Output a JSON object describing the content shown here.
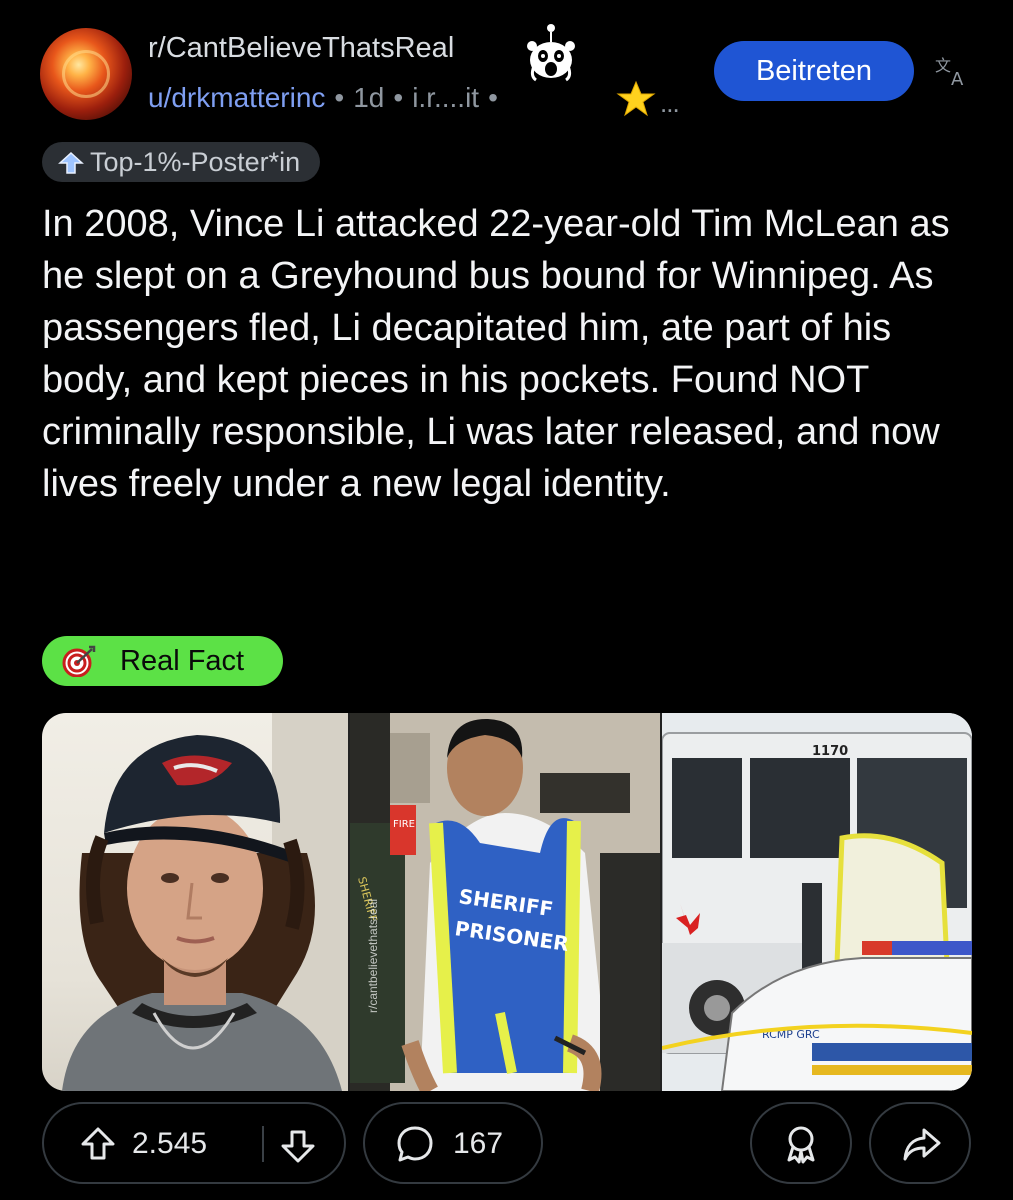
{
  "header": {
    "subreddit": "r/CantBelieveThatsReal",
    "user": "u/drkmatterinc",
    "age": "1d",
    "domain": "i.r....it",
    "more": "...",
    "separator": "•",
    "join_label": "Beitreten",
    "icons": [
      "subreddit-snoo-icon",
      "star-icon",
      "translate-icon"
    ]
  },
  "user_flair": {
    "label": "Top-1%-Poster*in",
    "icon": "top-poster-icon"
  },
  "post": {
    "title": "In 2008, Vince Li attacked 22-year-old Tim McLean as he slept on a Greyhound bus bound for Winnipeg. As passengers fled, Li decapitated him, ate part of his body, and kept pieces in his pockets. Found NOT criminally responsible, Li was later released, and now lives freely under a new legal identity.",
    "flair": {
      "label": "Real Fact",
      "icon": "target-icon",
      "color": "#5ce146"
    }
  },
  "gallery": {
    "watermark": "r/cantbelievethatsreal",
    "panels": [
      {
        "name": "portrait-young-man-cap"
      },
      {
        "name": "man-in-sheriff-prisoner-vest",
        "vest_text": [
          "SHERIFF",
          "PRISONER"
        ],
        "sign_text": "FIRE",
        "badge_text": "SHERIFF"
      },
      {
        "name": "greyhound-bus-and-rcmp-car",
        "bus_number": "1170",
        "car_text": "RCMP GRC"
      }
    ]
  },
  "actions": {
    "upvotes": "2.545",
    "comments": "167",
    "icons": [
      "upvote-icon",
      "downvote-icon",
      "comment-icon",
      "award-icon",
      "share-icon"
    ]
  },
  "colors": {
    "background": "#000000",
    "accent_blue": "#1f55d4",
    "username_blue": "#7f9ff2",
    "flair_green": "#5ce146",
    "pill_border": "#343a40"
  }
}
